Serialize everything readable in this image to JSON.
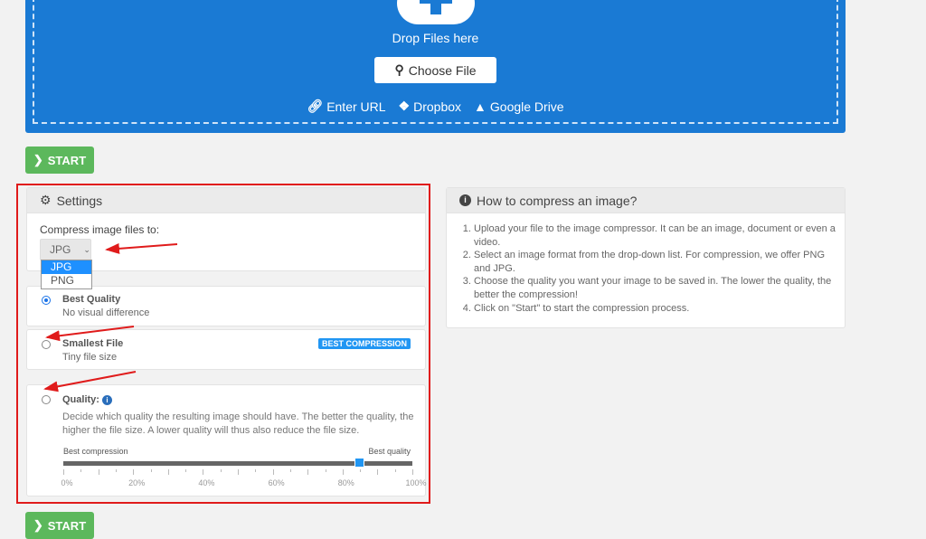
{
  "upload": {
    "drop_text": "Drop Files here",
    "choose_file": "Choose File",
    "links": [
      "Enter URL",
      "Dropbox",
      "Google Drive"
    ],
    "accent": "#1a7ad4"
  },
  "start_label": "START",
  "settings": {
    "title": "Settings",
    "compress_label": "Compress image files to:",
    "selected_format": "JPG",
    "format_options": [
      "JPG",
      "PNG"
    ],
    "options": [
      {
        "title": "Best Quality",
        "subtitle": "No visual difference",
        "selected": true
      },
      {
        "title": "Smallest File",
        "subtitle": "Tiny file size",
        "badge": "BEST COMPRESSION",
        "selected": false
      },
      {
        "title": "Quality:",
        "description": "Decide which quality the resulting image should have. The better the quality, the higher the file size. A lower quality will thus also reduce the file size.",
        "selected": false
      }
    ],
    "slider": {
      "left_label": "Best compression",
      "right_label": "Best quality",
      "value_percent": 85,
      "tick_labels": [
        "0%",
        "20%",
        "40%",
        "60%",
        "80%",
        "100%"
      ]
    }
  },
  "howto": {
    "title": "How to compress an image?",
    "steps": [
      "Upload your file to the image compressor. It can be an image, document or even a video.",
      "Select an image format from the drop-down list. For compression, we offer PNG and JPG.",
      "Choose the quality you want your image to be saved in. The lower the quality, the better the compression!",
      "Click on \"Start\" to start the compression process."
    ]
  }
}
